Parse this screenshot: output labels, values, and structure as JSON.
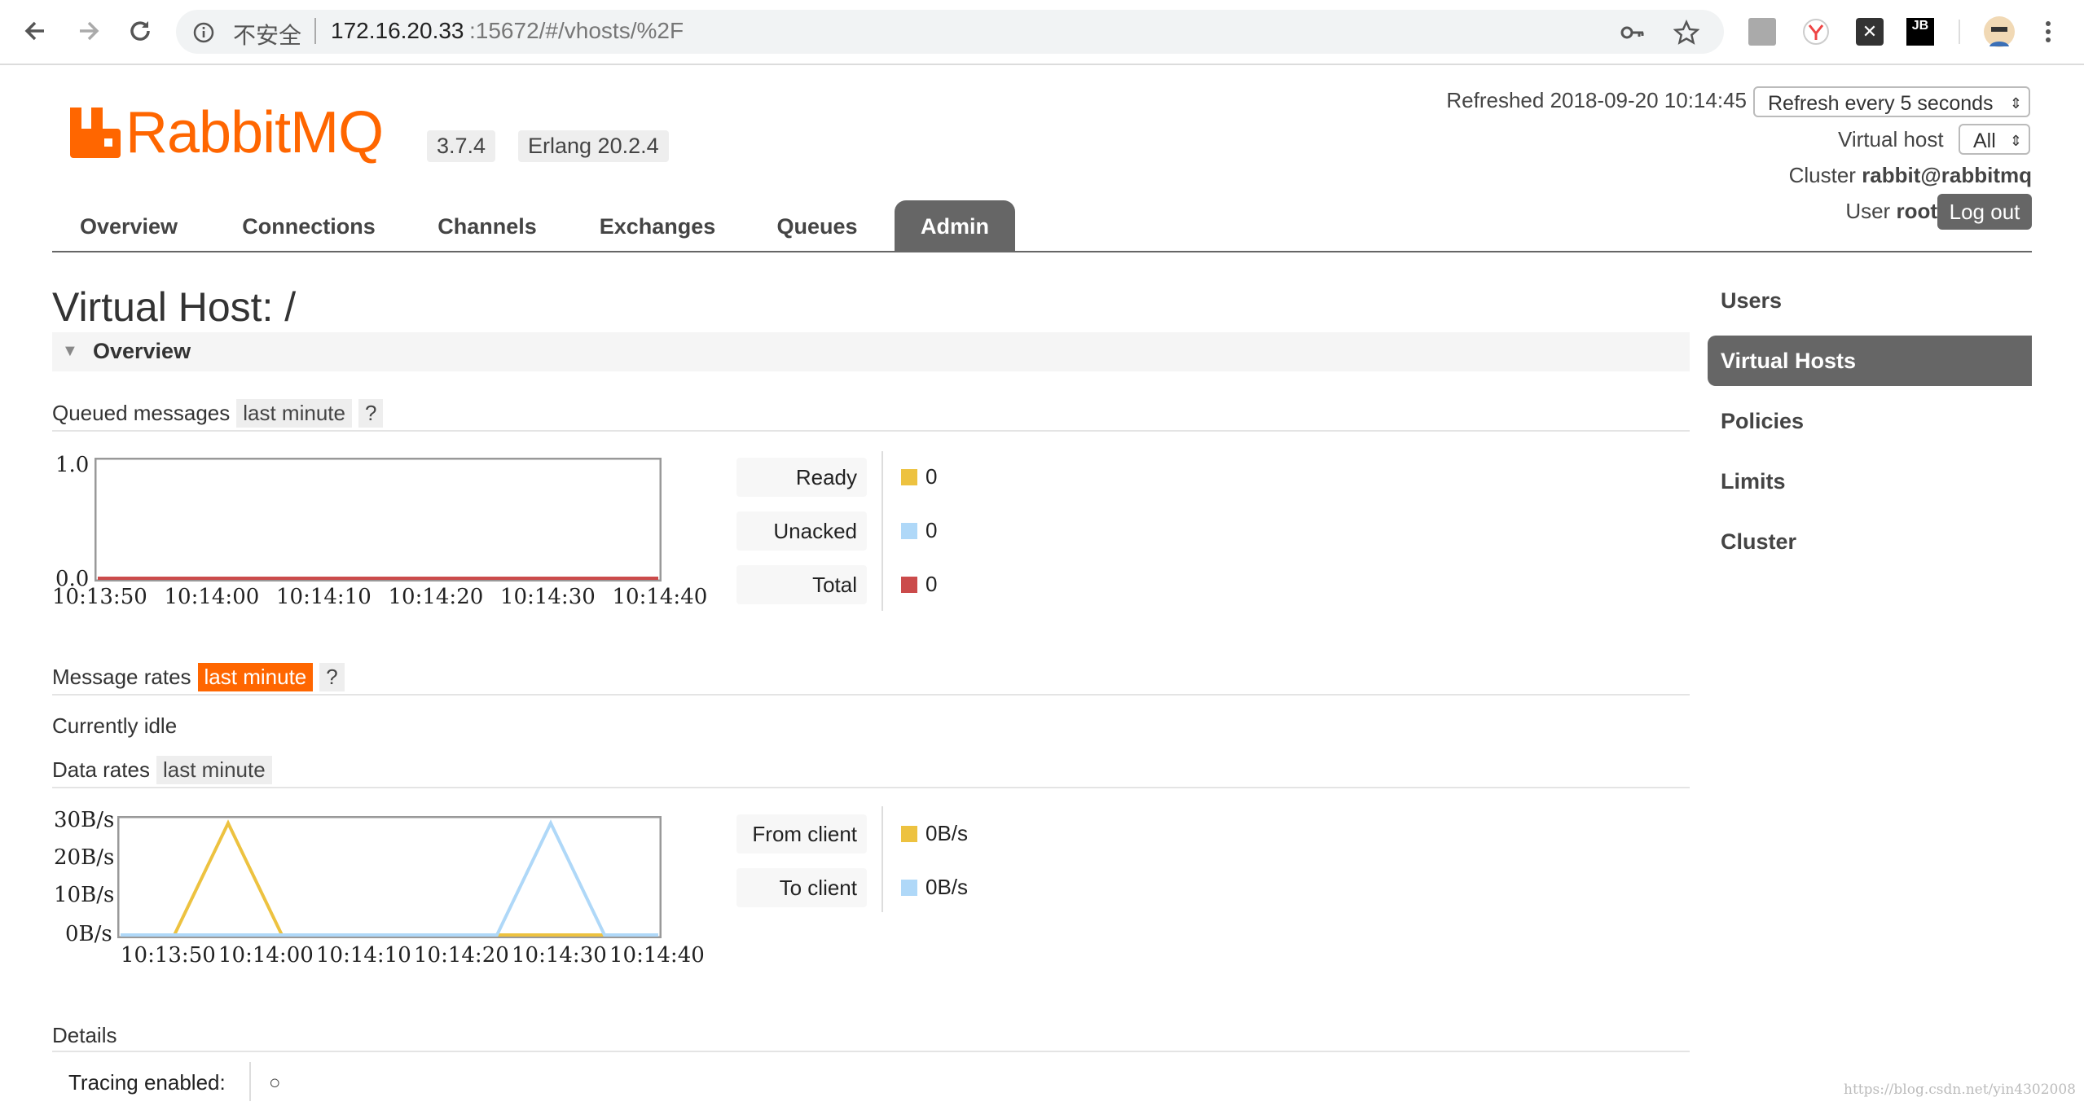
{
  "browser": {
    "insecure_label": "不安全",
    "url_host": "172.16.20.33",
    "url_rest": ":15672/#/vhosts/%2F"
  },
  "app": {
    "logo_text": "RabbitMQ",
    "version": "3.7.4",
    "erlang": "Erlang 20.2.4",
    "refreshed_label": "Refreshed 2018-09-20 10:14:45",
    "refresh_select": "Refresh every 5 seconds",
    "vhost_label": "Virtual host",
    "vhost_select": "All",
    "cluster_label": "Cluster",
    "cluster_value": "rabbit@rabbitmq",
    "user_label": "User",
    "user_value": "root",
    "logout": "Log out"
  },
  "tabs": [
    "Overview",
    "Connections",
    "Channels",
    "Exchanges",
    "Queues",
    "Admin"
  ],
  "active_tab": "Admin",
  "sidebar": [
    "Users",
    "Virtual Hosts",
    "Policies",
    "Limits",
    "Cluster"
  ],
  "active_sidebar": "Virtual Hosts",
  "page": {
    "title": "Virtual Host: /",
    "overview_header": "Overview",
    "queued_label": "Queued messages",
    "queued_range": "last minute",
    "help": "?",
    "rates_label": "Message rates",
    "rates_range": "last minute",
    "idle": "Currently idle",
    "data_rates_label": "Data rates",
    "data_rates_range": "last minute",
    "details_label": "Details",
    "tracing_label": "Tracing enabled:",
    "tracing_value": "○"
  },
  "queued_legend": [
    {
      "label": "Ready",
      "value": "0",
      "color": "#edc240"
    },
    {
      "label": "Unacked",
      "value": "0",
      "color": "#afd8f8"
    },
    {
      "label": "Total",
      "value": "0",
      "color": "#cb4b4b"
    }
  ],
  "rates_legend": [
    {
      "label": "From client",
      "value": "0B/s",
      "color": "#edc240"
    },
    {
      "label": "To client",
      "value": "0B/s",
      "color": "#afd8f8"
    }
  ],
  "watermark": "https://blog.csdn.net/yin4302008",
  "chart_data": [
    {
      "type": "line",
      "title": "Queued messages",
      "x": [
        "10:13:50",
        "10:14:00",
        "10:14:10",
        "10:14:20",
        "10:14:30",
        "10:14:40"
      ],
      "yticks": [
        "0.0",
        "1.0"
      ],
      "ylim": [
        0,
        1
      ],
      "series": [
        {
          "name": "Ready",
          "values": [
            0,
            0,
            0,
            0,
            0,
            0
          ],
          "color": "#edc240"
        },
        {
          "name": "Unacked",
          "values": [
            0,
            0,
            0,
            0,
            0,
            0
          ],
          "color": "#afd8f8"
        },
        {
          "name": "Total",
          "values": [
            0,
            0,
            0,
            0,
            0,
            0
          ],
          "color": "#cb4b4b"
        }
      ]
    },
    {
      "type": "line",
      "title": "Data rates",
      "x": [
        "10:13:50",
        "10:14:00",
        "10:14:10",
        "10:14:20",
        "10:14:30",
        "10:14:40"
      ],
      "yticks": [
        "0B/s",
        "10B/s",
        "20B/s",
        "30B/s"
      ],
      "ylim": [
        0,
        30
      ],
      "series": [
        {
          "name": "From client",
          "points": [
            [
              0,
              0
            ],
            [
              5,
              0
            ],
            [
              10,
              29
            ],
            [
              15,
              0
            ],
            [
              50,
              0
            ]
          ],
          "color": "#edc240"
        },
        {
          "name": "To client",
          "points": [
            [
              0,
              0
            ],
            [
              35,
              0
            ],
            [
              40,
              29
            ],
            [
              45,
              0
            ],
            [
              50,
              0
            ]
          ],
          "color": "#afd8f8"
        }
      ]
    }
  ]
}
